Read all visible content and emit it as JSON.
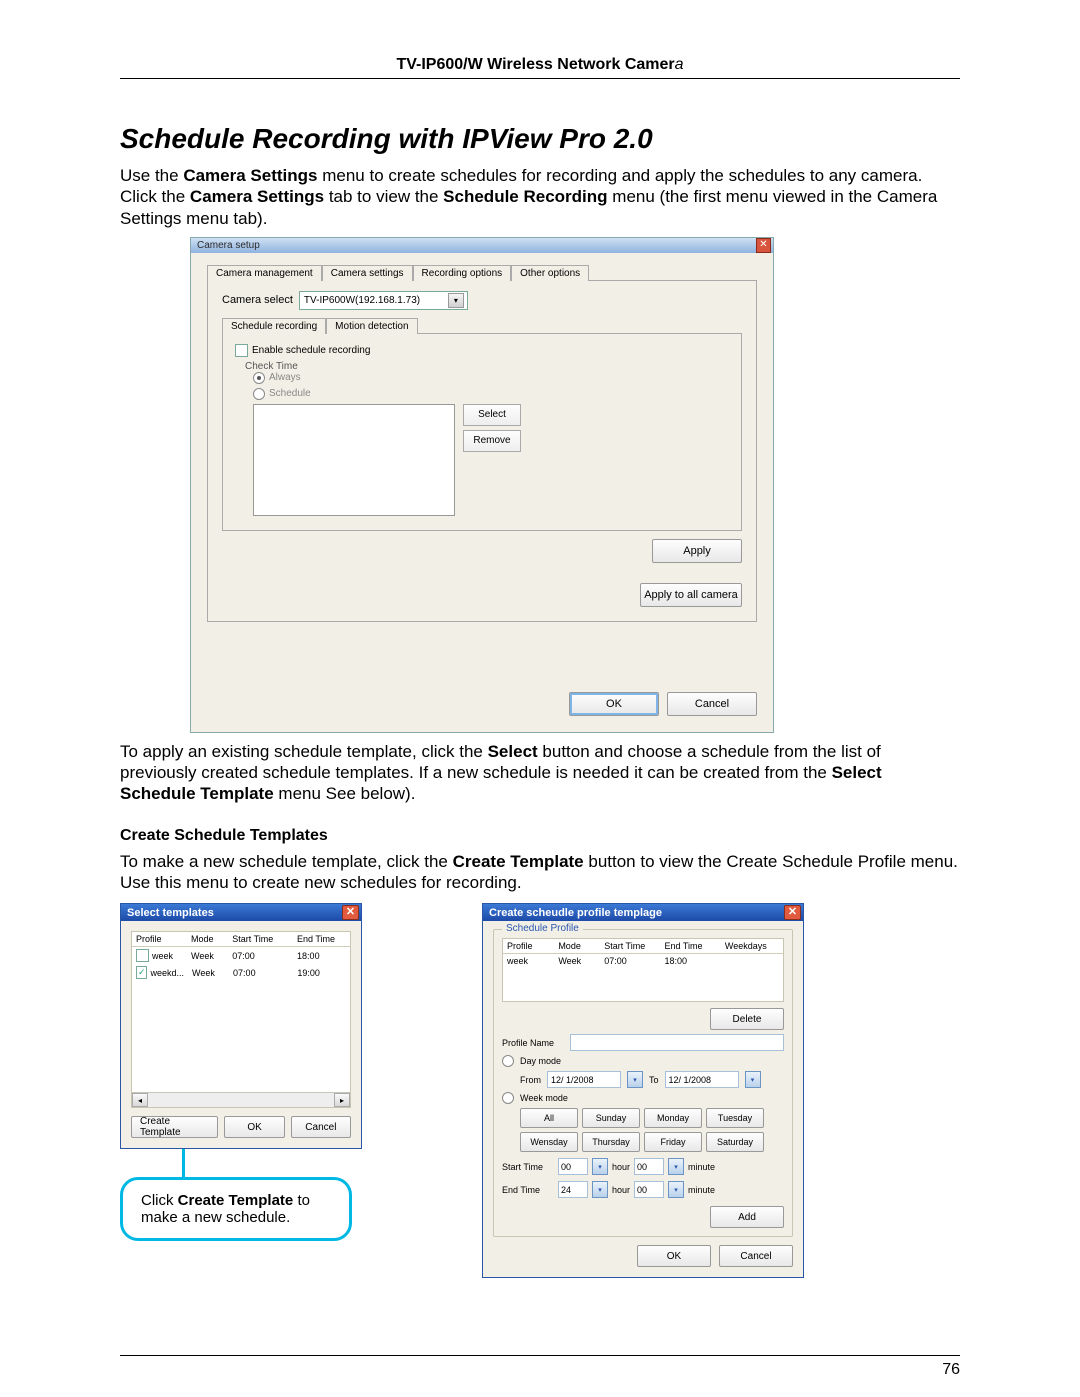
{
  "header": {
    "product_bold": "TV-IP600/W Wireless Network Camer",
    "product_italic_tail": "a"
  },
  "section_title": "Schedule Recording with IPView Pro 2.0",
  "intro": {
    "t1a": "Use the ",
    "t1b": "Camera Settings",
    "t1c": " menu to create schedules for recording and apply the schedules to any camera. Click the ",
    "t1d": "Camera Settings",
    "t1e": " tab to view the ",
    "t1f": "Schedule Recording",
    "t1g": " menu (the first menu viewed in the Camera Settings menu tab)."
  },
  "camera_setup": {
    "title": "Camera setup",
    "tabs": [
      "Camera management",
      "Camera settings",
      "Recording options",
      "Other options"
    ],
    "camera_select_label": "Camera select",
    "camera_select_value": "TV-IP600W(192.168.1.73)",
    "subtabs": [
      "Schedule recording",
      "Motion detection"
    ],
    "enable_chk": "Enable schedule recording",
    "check_time": "Check Time",
    "opt_always": "Always",
    "opt_schedule": "Schedule",
    "btn_select": "Select",
    "btn_remove": "Remove",
    "btn_apply": "Apply",
    "btn_apply_all": "Apply to all camera",
    "btn_ok": "OK",
    "btn_cancel": "Cancel"
  },
  "mid_para": {
    "a": "To apply an existing schedule template, click the ",
    "b": "Select",
    "c": " button and choose a schedule from the list of previously created schedule templates. If a new schedule is needed it can be created from the ",
    "d": "Select Schedule Template",
    "e": " menu See below)."
  },
  "sub_heading": "Create Schedule Templates",
  "sub_para": {
    "a": "To make a new schedule template, click the ",
    "b": "Create Template",
    "c": " button to view the Create Schedule Profile menu. Use this menu to create new schedules for recording."
  },
  "select_templates": {
    "title": "Select templates",
    "cols": [
      "Profile",
      "Mode",
      "Start Time",
      "End Time"
    ],
    "rows": [
      {
        "checked": false,
        "profile": "week",
        "mode": "Week",
        "start": "07:00",
        "end": "18:00"
      },
      {
        "checked": true,
        "profile": "weekd...",
        "mode": "Week",
        "start": "07:00",
        "end": "19:00"
      }
    ],
    "btn_create": "Create Template",
    "btn_ok": "OK",
    "btn_cancel": "Cancel"
  },
  "callout": {
    "a": "Click ",
    "b": "Create Template",
    "c": " to make a new schedule."
  },
  "create_schedule": {
    "title": "Create scheudle profile templage",
    "group_label": "Schedule Profile",
    "cols": [
      "Profile",
      "Mode",
      "Start Time",
      "End Time",
      "Weekdays"
    ],
    "row": {
      "profile": "week",
      "mode": "Week",
      "start": "07:00",
      "end": "18:00",
      "weekdays": ""
    },
    "btn_delete": "Delete",
    "profile_name_label": "Profile Name",
    "day_mode": "Day mode",
    "from": "From",
    "to": "To",
    "date1": "12/ 1/2008",
    "date2": "12/ 1/2008",
    "week_mode": "Week mode",
    "days": [
      "All",
      "Sunday",
      "Monday",
      "Tuesday",
      "Wensday",
      "Thursday",
      "Friday",
      "Saturday"
    ],
    "start_time_lbl": "Start Time",
    "end_time_lbl": "End Time",
    "start_h": "00",
    "start_m": "00",
    "end_h": "24",
    "end_m": "00",
    "hour": "hour",
    "minute": "minute",
    "btn_add": "Add",
    "btn_ok": "OK",
    "btn_cancel": "Cancel"
  },
  "page_number": "76"
}
